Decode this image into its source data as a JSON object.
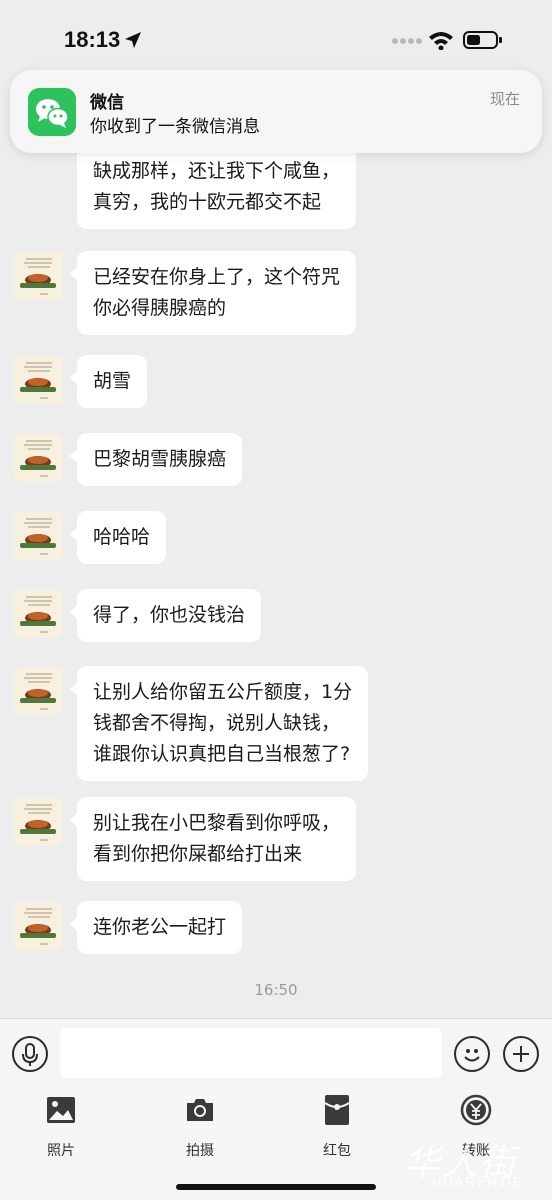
{
  "status_bar": {
    "time": "18:13",
    "icons": [
      "location-arrow-icon",
      "signal-dots-icon",
      "wifi-icon",
      "battery-icon"
    ]
  },
  "notification": {
    "app_name": "微信",
    "message": "你收到了一条微信消息",
    "time": "现在",
    "icon": "wechat-icon"
  },
  "chat": {
    "messages": [
      {
        "lines": [
          "缺成那样，还让我下个咸鱼，",
          "真穷，我的十欧元都交不起"
        ]
      },
      {
        "lines": [
          "已经安在你身上了，这个符咒",
          "你必得胰腺癌的"
        ]
      },
      {
        "lines": [
          "胡雪"
        ]
      },
      {
        "lines": [
          "巴黎胡雪胰腺癌"
        ]
      },
      {
        "lines": [
          "哈哈哈"
        ]
      },
      {
        "lines": [
          "得了，你也没钱治"
        ]
      },
      {
        "lines": [
          "让别人给你留五公斤额度，1分",
          "钱都舍不得掏，说别人缺钱，",
          "谁跟你认识真把自己当根葱了?"
        ]
      },
      {
        "lines": [
          "别让我在小巴黎看到你呼吸，",
          "看到你把你屎都给打出来"
        ]
      },
      {
        "lines": [
          "连你老公一起打"
        ]
      }
    ],
    "time_divider": "16:50"
  },
  "input_bar": {
    "placeholder": "",
    "icons": [
      "voice-icon",
      "emoji-icon",
      "plus-icon"
    ]
  },
  "tools": [
    {
      "label": "照片",
      "icon": "photo-icon"
    },
    {
      "label": "拍摄",
      "icon": "camera-icon"
    },
    {
      "label": "红包",
      "icon": "red-packet-icon"
    },
    {
      "label": "转账",
      "icon": "transfer-icon"
    }
  ],
  "watermark": {
    "chinese": "华人街",
    "english": "HUARENJIE"
  },
  "colors": {
    "background": "#ededed",
    "bubble": "#ffffff",
    "wechat_green": "#2dc25b"
  }
}
